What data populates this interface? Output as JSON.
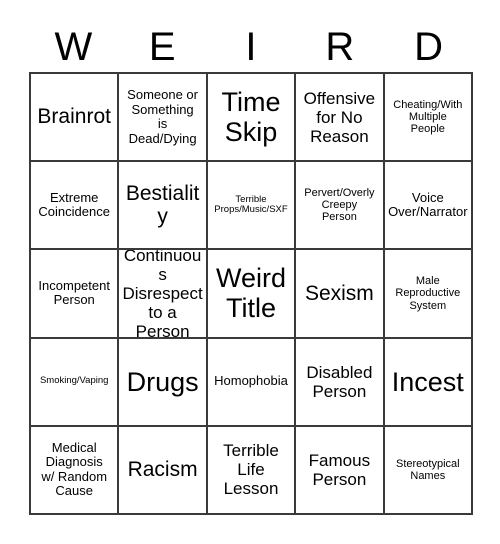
{
  "card": {
    "title_letters": [
      "W",
      "E",
      "I",
      "R",
      "D"
    ],
    "columns": 5,
    "rows": 5,
    "border_color": "#3a3a3a",
    "background_color": "#ffffff",
    "text_color": "#000000",
    "free_space_label": "Weird Title",
    "free_space_position": "center"
  },
  "cells": [
    {
      "id": "r1c1",
      "row": 1,
      "col": 1,
      "column_letter": "W",
      "text": "Brainrot",
      "size": "lg"
    },
    {
      "id": "r1c2",
      "row": 1,
      "col": 2,
      "column_letter": "E",
      "text": "Someone or\nSomething\nis\nDead/Dying",
      "size": "sm"
    },
    {
      "id": "r1c3",
      "row": 1,
      "col": 3,
      "column_letter": "I",
      "text": "Time\nSkip",
      "size": "xl"
    },
    {
      "id": "r1c4",
      "row": 1,
      "col": 4,
      "column_letter": "R",
      "text": "Offensive\nfor No\nReason",
      "size": "md"
    },
    {
      "id": "r1c5",
      "row": 1,
      "col": 5,
      "column_letter": "D",
      "text": "Cheating/With\nMultiple\nPeople",
      "size": "xs"
    },
    {
      "id": "r2c1",
      "row": 2,
      "col": 1,
      "column_letter": "W",
      "text": "Extreme\nCoincidence",
      "size": "sm"
    },
    {
      "id": "r2c2",
      "row": 2,
      "col": 2,
      "column_letter": "E",
      "text": "Bestiality",
      "size": "lg"
    },
    {
      "id": "r2c3",
      "row": 2,
      "col": 3,
      "column_letter": "I",
      "text": "Terrible\nProps/Music/SXF",
      "size": "xxs"
    },
    {
      "id": "r2c4",
      "row": 2,
      "col": 4,
      "column_letter": "R",
      "text": "Pervert/Overly\nCreepy\nPerson",
      "size": "xs"
    },
    {
      "id": "r2c5",
      "row": 2,
      "col": 5,
      "column_letter": "D",
      "text": "Voice\nOver/Narrator",
      "size": "sm"
    },
    {
      "id": "r3c1",
      "row": 3,
      "col": 1,
      "column_letter": "W",
      "text": "Incompetent\nPerson",
      "size": "sm"
    },
    {
      "id": "r3c2",
      "row": 3,
      "col": 2,
      "column_letter": "E",
      "text": "Continuous\nDisrespect\nto a Person",
      "size": "md"
    },
    {
      "id": "r3c3",
      "row": 3,
      "col": 3,
      "column_letter": "I",
      "text": "Weird\nTitle",
      "size": "xl"
    },
    {
      "id": "r3c4",
      "row": 3,
      "col": 4,
      "column_letter": "R",
      "text": "Sexism",
      "size": "lg"
    },
    {
      "id": "r3c5",
      "row": 3,
      "col": 5,
      "column_letter": "D",
      "text": "Male\nReproductive\nSystem",
      "size": "xs"
    },
    {
      "id": "r4c1",
      "row": 4,
      "col": 1,
      "column_letter": "W",
      "text": "Smoking/Vaping",
      "size": "xxs"
    },
    {
      "id": "r4c2",
      "row": 4,
      "col": 2,
      "column_letter": "E",
      "text": "Drugs",
      "size": "xl"
    },
    {
      "id": "r4c3",
      "row": 4,
      "col": 3,
      "column_letter": "I",
      "text": "Homophobia",
      "size": "sm"
    },
    {
      "id": "r4c4",
      "row": 4,
      "col": 4,
      "column_letter": "R",
      "text": "Disabled\nPerson",
      "size": "md"
    },
    {
      "id": "r4c5",
      "row": 4,
      "col": 5,
      "column_letter": "D",
      "text": "Incest",
      "size": "xl"
    },
    {
      "id": "r5c1",
      "row": 5,
      "col": 1,
      "column_letter": "W",
      "text": "Medical\nDiagnosis\nw/ Random\nCause",
      "size": "sm"
    },
    {
      "id": "r5c2",
      "row": 5,
      "col": 2,
      "column_letter": "E",
      "text": "Racism",
      "size": "lg"
    },
    {
      "id": "r5c3",
      "row": 5,
      "col": 3,
      "column_letter": "I",
      "text": "Terrible\nLife\nLesson",
      "size": "md"
    },
    {
      "id": "r5c4",
      "row": 5,
      "col": 4,
      "column_letter": "R",
      "text": "Famous\nPerson",
      "size": "md"
    },
    {
      "id": "r5c5",
      "row": 5,
      "col": 5,
      "column_letter": "D",
      "text": "Stereotypical\nNames",
      "size": "xs"
    }
  ]
}
